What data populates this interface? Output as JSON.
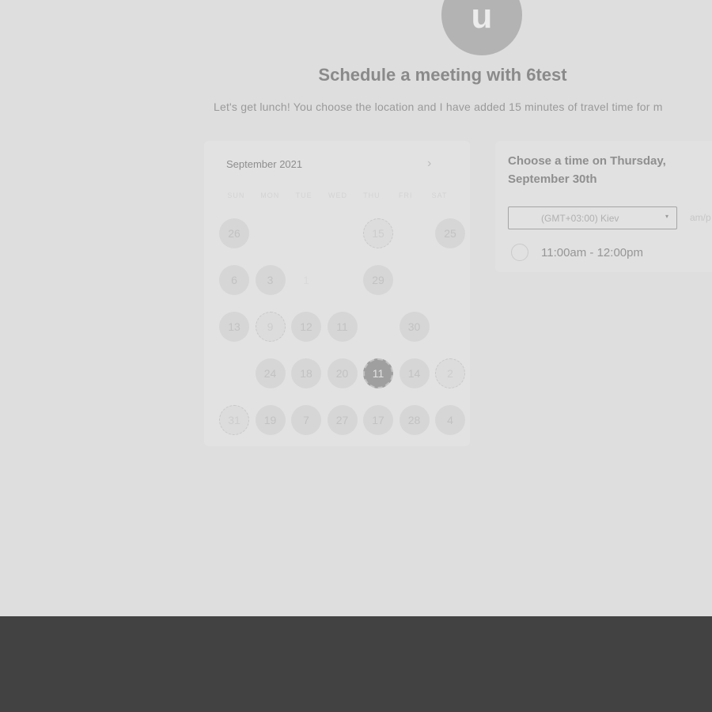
{
  "header": {
    "avatar_letter": "u",
    "title": "Schedule a meeting with 6test",
    "subtitle": "Let's get lunch! You choose the location and I have added 15 minutes of travel time for m"
  },
  "calendar": {
    "month_label": "September 2021",
    "next_icon": "chevron-right-icon",
    "weekdays": [
      "SUN",
      "MON",
      "TUE",
      "WED",
      "THU",
      "FRI",
      "SAT"
    ],
    "rows": [
      [
        "26",
        "",
        "",
        "",
        "15",
        "",
        "25"
      ],
      [
        "6",
        "3",
        "1",
        "",
        "29",
        "",
        ""
      ],
      [
        "13",
        "9",
        "12",
        "11",
        "",
        "30",
        ""
      ],
      [
        "",
        "24",
        "18",
        "20",
        "11",
        "14",
        "2"
      ],
      [
        "31",
        "19",
        "7",
        "27",
        "17",
        "28",
        "4"
      ]
    ],
    "selected": "11"
  },
  "time_panel": {
    "heading": "Choose a time on Thursday, September 30th",
    "timezone": "(GMT+03:00) Kiev",
    "format_toggle": "am/p",
    "slots": [
      "11:00am - 12:00pm"
    ]
  }
}
